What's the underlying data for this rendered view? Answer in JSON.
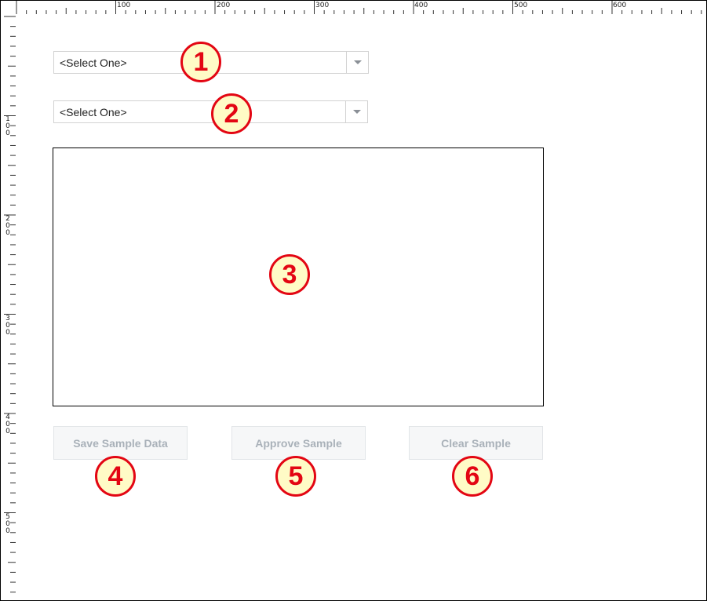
{
  "ruler": {
    "top_labels": [
      "100",
      "200",
      "300",
      "400",
      "500",
      "600"
    ],
    "left_labels": [
      "100",
      "200",
      "300",
      "400",
      "500"
    ]
  },
  "dropdown_1": {
    "value": "<Select One>",
    "arrow_icon": "chevron-down-icon"
  },
  "dropdown_2": {
    "value": "<Select One>",
    "arrow_icon": "chevron-down-icon"
  },
  "buttons": {
    "save": "Save Sample Data",
    "approve": "Approve Sample",
    "clear": "Clear Sample"
  },
  "callouts": [
    "1",
    "2",
    "3",
    "4",
    "5",
    "6"
  ],
  "colors": {
    "callout_border": "#e30613",
    "callout_fill": "#fffbc6",
    "disabled_text": "#a9b1b9"
  }
}
